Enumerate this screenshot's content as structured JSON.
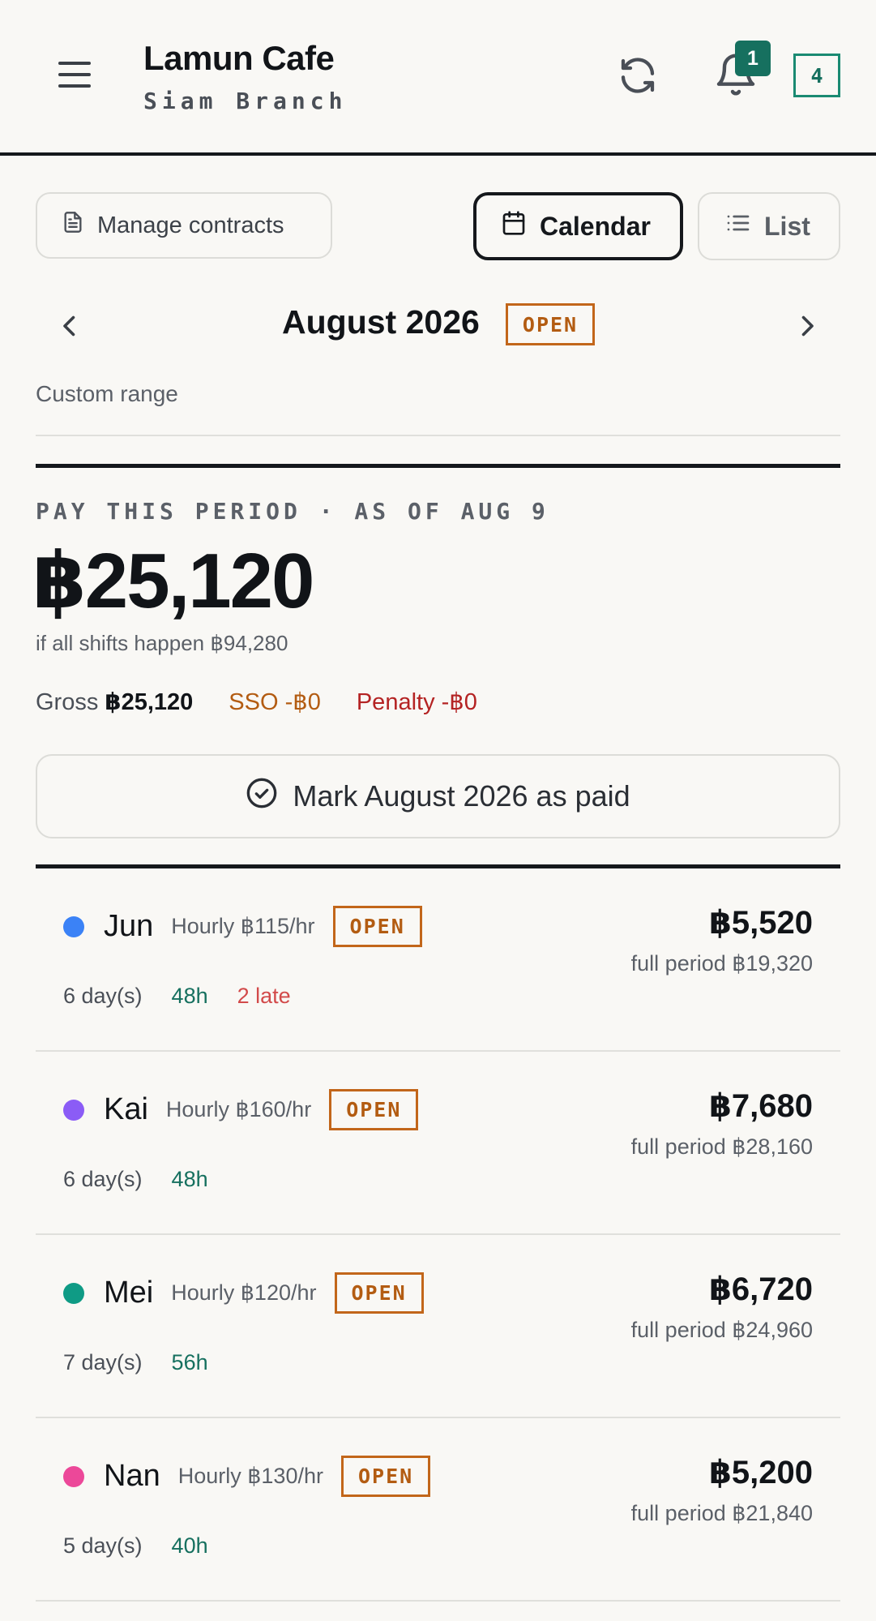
{
  "header": {
    "title": "Lamun Cafe",
    "subtitle": "Siam Branch",
    "notification_count": "1",
    "count_box": "4"
  },
  "toolbar": {
    "contracts_label": "Manage contracts",
    "calendar_label": "Calendar",
    "list_label": "List"
  },
  "period": {
    "month": "August 2026",
    "status": "OPEN",
    "custom_range": "Custom range"
  },
  "pay": {
    "heading": "PAY THIS PERIOD · AS OF AUG 9",
    "amount": "฿25,120",
    "projection": "if all shifts happen ฿94,280",
    "gross_label": "Gross",
    "gross_value": "฿25,120",
    "sso": "SSO -฿0",
    "penalty": "Penalty -฿0",
    "mark_paid_label": "Mark August 2026 as paid"
  },
  "employees": [
    {
      "name": "Jun",
      "color": "#3b82f6",
      "rate": "Hourly ฿115/hr",
      "status": "OPEN",
      "days": "6 day(s)",
      "hours": "48h",
      "late": "2 late",
      "amount": "฿5,520",
      "full_period": "full period ฿19,320"
    },
    {
      "name": "Kai",
      "color": "#8b5cf6",
      "rate": "Hourly ฿160/hr",
      "status": "OPEN",
      "days": "6 day(s)",
      "hours": "48h",
      "late": "",
      "amount": "฿7,680",
      "full_period": "full period ฿28,160"
    },
    {
      "name": "Mei",
      "color": "#0f9b85",
      "rate": "Hourly ฿120/hr",
      "status": "OPEN",
      "days": "7 day(s)",
      "hours": "56h",
      "late": "",
      "amount": "฿6,720",
      "full_period": "full period ฿24,960"
    },
    {
      "name": "Nan",
      "color": "#ec4899",
      "rate": "Hourly ฿130/hr",
      "status": "OPEN",
      "days": "5 day(s)",
      "hours": "40h",
      "late": "",
      "amount": "฿5,200",
      "full_period": "full period ฿21,840"
    }
  ]
}
